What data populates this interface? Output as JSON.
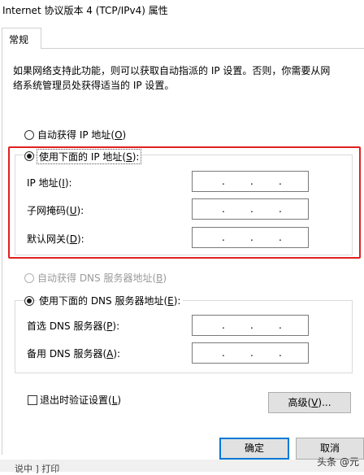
{
  "window": {
    "title": "Internet 协议版本 4 (TCP/IPv4) 属性"
  },
  "tabs": {
    "general": "常规"
  },
  "description": {
    "line1": "如果网络支持此功能，则可以获取自动指派的 IP 设置。否则，你需要从网",
    "line2": "络系统管理员处获得适当的 IP 设置。"
  },
  "ip": {
    "auto_prefix": "自动获得 IP 地址(",
    "auto_key": "O",
    "auto_suffix": ")",
    "manual_prefix": "使用下面的 IP 地址(",
    "manual_key": "S",
    "manual_suffix": "):",
    "address_prefix": "IP 地址(",
    "address_key": "I",
    "address_suffix": "):",
    "mask_prefix": "子网掩码(",
    "mask_key": "U",
    "mask_suffix": "):",
    "gateway_prefix": "默认网关(",
    "gateway_key": "D",
    "gateway_suffix": "):"
  },
  "dns": {
    "auto_prefix": "自动获得 DNS 服务器地址(",
    "auto_key": "B",
    "auto_suffix": ")",
    "manual_prefix": "使用下面的 DNS 服务器地址(",
    "manual_key": "E",
    "manual_suffix": "):",
    "preferred_prefix": "首选 DNS 服务器(",
    "preferred_key": "P",
    "preferred_suffix": "):",
    "alternate_prefix": "备用 DNS 服务器(",
    "alternate_key": "A",
    "alternate_suffix": "):"
  },
  "field_dot": ".",
  "options": {
    "validate_prefix": "退出时验证设置(",
    "validate_key": "L",
    "validate_suffix": ")",
    "advanced_prefix": "高级(",
    "advanced_key": "V",
    "advanced_suffix": ")..."
  },
  "buttons": {
    "ok": "确定",
    "cancel": "取消"
  },
  "watermark": "头条 @元",
  "cut_text": "说中 ] 打印"
}
